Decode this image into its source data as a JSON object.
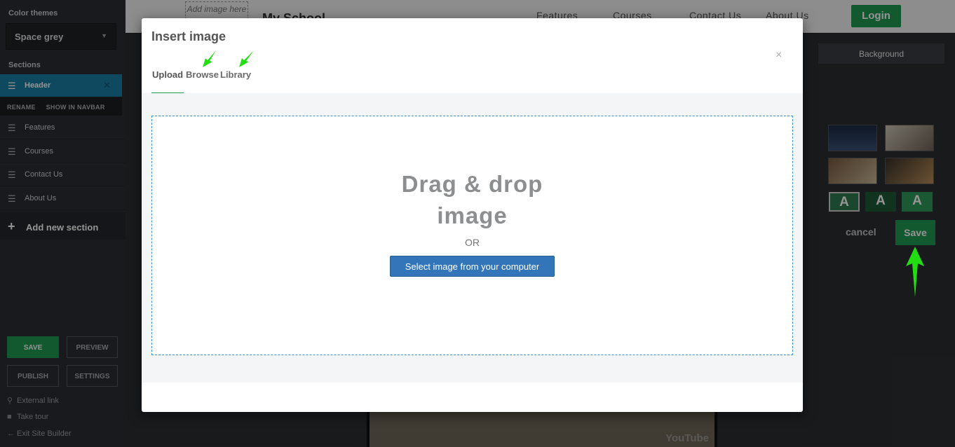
{
  "sidebar": {
    "color_themes_label": "Color themes",
    "theme_value": "Space grey",
    "sections_label": "Sections",
    "sections": [
      {
        "label": "Header"
      },
      {
        "label": "Features"
      },
      {
        "label": "Courses"
      },
      {
        "label": "Contact Us"
      },
      {
        "label": "About Us"
      }
    ],
    "section_actions": {
      "rename": "RENAME",
      "show_in_navbar": "SHOW IN NAVBAR"
    },
    "add_section": "Add new section",
    "buttons": {
      "save": "SAVE",
      "preview": "PREVIEW",
      "publish": "PUBLISH",
      "settings": "SETTINGS"
    },
    "links": {
      "external": "External link",
      "tour": "Take tour",
      "exit": "Exit Site Builder"
    }
  },
  "topnav": {
    "add_image": "Add image here",
    "brand": "My School",
    "links": [
      "Features",
      "Courses",
      "Contact Us",
      "About Us"
    ],
    "login": "Login"
  },
  "right_panel": {
    "background_tab": "Background",
    "a_label": "A",
    "cancel": "cancel",
    "save": "Save"
  },
  "video": {
    "watermark": "YouTube"
  },
  "modal": {
    "title": "Insert image",
    "close": "×",
    "tabs": [
      "Upload",
      "Browse",
      "Library"
    ],
    "dropzone_line1": "Drag & drop",
    "dropzone_line2": "image",
    "or": "OR",
    "select_button": "Select image from your computer"
  },
  "colors": {
    "accent_green": "#1f9a53",
    "primary_blue": "#3276b9",
    "annotation_green": "#22dd11"
  }
}
